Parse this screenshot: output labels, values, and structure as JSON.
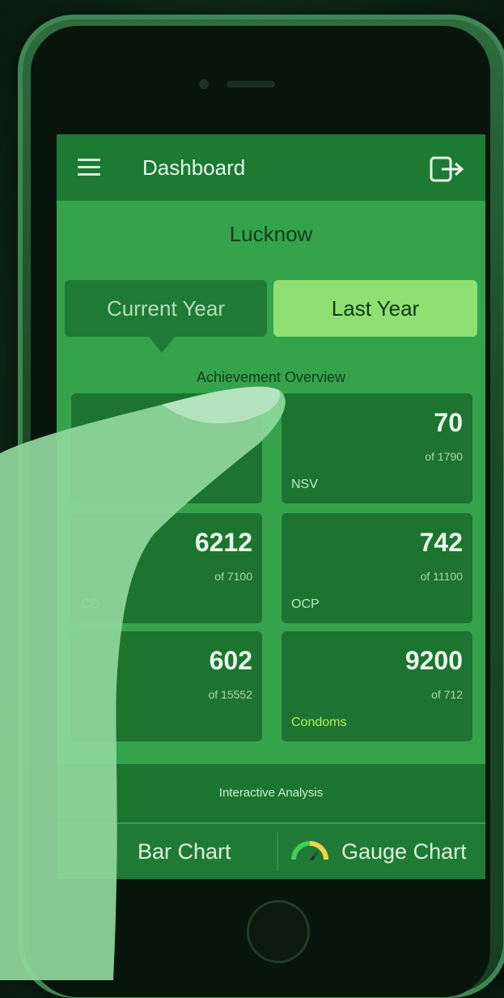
{
  "header": {
    "title": "Dashboard"
  },
  "location": "Lucknow",
  "tabs": {
    "current_year": "Current Year",
    "last_year": "Last Year",
    "selected": "Last Year"
  },
  "section_title": "Achievement Overview",
  "cards": [
    {
      "value": "",
      "total": "",
      "label": ""
    },
    {
      "value": "70",
      "total": "of 1790",
      "label": "NSV"
    },
    {
      "value": "6212",
      "total": "of 7100",
      "label": "CD"
    },
    {
      "value": "742",
      "total": "of 11100",
      "label": "OCP"
    },
    {
      "value": "602",
      "total": "of 15552",
      "label": ""
    },
    {
      "value": "9200",
      "total": "of 712",
      "label": "Condoms"
    }
  ],
  "analysis": {
    "title": "Interactive Analysis",
    "bar_chart": "Bar Chart",
    "gauge_chart": "Gauge Chart"
  },
  "icons": {
    "menu": "hamburger-menu-icon",
    "logout": "logout-icon",
    "gauge": "gauge-icon"
  },
  "colors": {
    "appbar": "#1c7a33",
    "screen_bg": "#35a34c",
    "card_bg": "#1d7330",
    "tab_selected": "#8fdf72",
    "accent_label": "#b6f05e"
  }
}
